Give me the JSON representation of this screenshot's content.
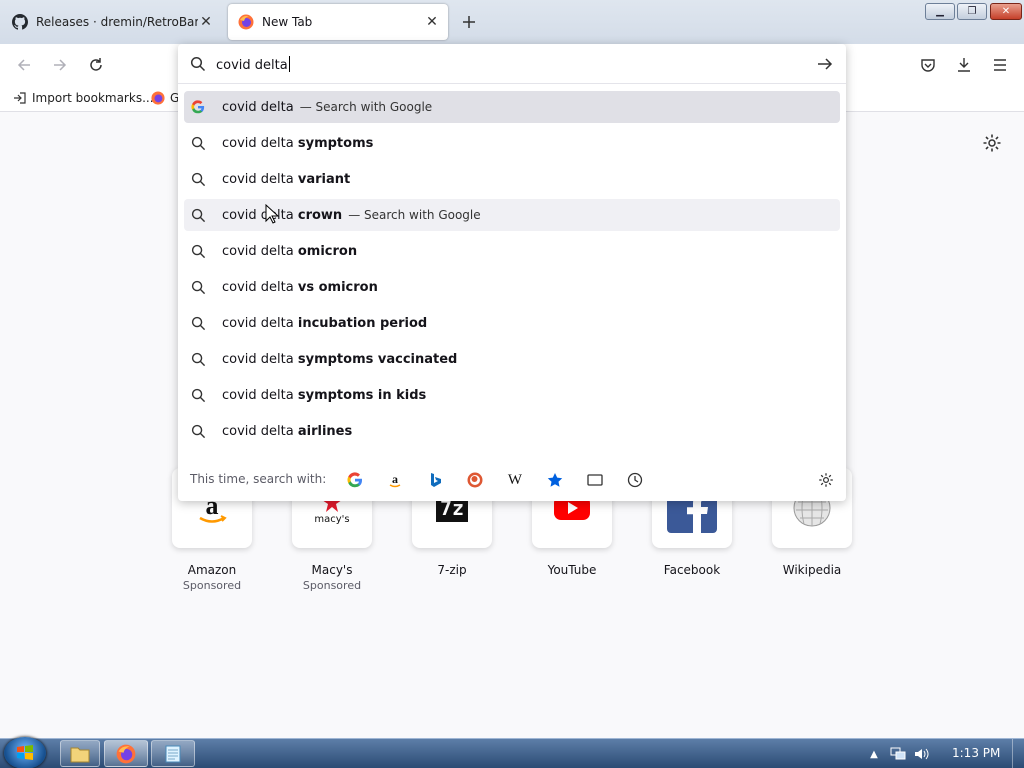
{
  "tabs": [
    {
      "title": "Releases · dremin/RetroBar · Git",
      "icon": "github-icon",
      "active": false
    },
    {
      "title": "New Tab",
      "icon": "firefox-icon",
      "active": true
    }
  ],
  "urlbar": {
    "value": "covid delta",
    "results": [
      {
        "typed": "covid delta",
        "suggest": "",
        "action": "— Search with Google",
        "icon": "google-icon",
        "state": "selected"
      },
      {
        "typed": "covid delta ",
        "suggest": "symptoms",
        "action": "",
        "icon": "search-icon",
        "state": ""
      },
      {
        "typed": "covid delta ",
        "suggest": "variant",
        "action": "",
        "icon": "search-icon",
        "state": ""
      },
      {
        "typed": "covid delta ",
        "suggest": "crown",
        "action": "— Search with Google",
        "icon": "search-icon",
        "state": "hovered"
      },
      {
        "typed": "covid delta ",
        "suggest": "omicron",
        "action": "",
        "icon": "search-icon",
        "state": ""
      },
      {
        "typed": "covid delta ",
        "suggest": "vs omicron",
        "action": "",
        "icon": "search-icon",
        "state": ""
      },
      {
        "typed": "covid delta ",
        "suggest": "incubation period",
        "action": "",
        "icon": "search-icon",
        "state": ""
      },
      {
        "typed": "covid delta ",
        "suggest": "symptoms vaccinated",
        "action": "",
        "icon": "search-icon",
        "state": ""
      },
      {
        "typed": "covid delta ",
        "suggest": "symptoms in kids",
        "action": "",
        "icon": "search-icon",
        "state": ""
      },
      {
        "typed": "covid delta ",
        "suggest": "airlines",
        "action": "",
        "icon": "search-icon",
        "state": ""
      }
    ],
    "oneoff_label": "This time, search with:",
    "oneoff_engines": [
      "google-icon",
      "amazon-icon",
      "bing-icon",
      "duckduckgo-icon",
      "wikipedia-icon",
      "bookmarks-icon",
      "tabs-icon",
      "history-icon"
    ]
  },
  "bookmarks": [
    {
      "label": "Import bookmarks...",
      "icon": "import-icon"
    },
    {
      "label": "G",
      "icon": "firefox-icon"
    }
  ],
  "shortcuts": [
    {
      "title": "Amazon",
      "sponsor": "Sponsored"
    },
    {
      "title": "Macy's",
      "sponsor": "Sponsored",
      "tile_text": "macy's"
    },
    {
      "title": "7-zip",
      "sponsor": "",
      "tile_text": "7z"
    },
    {
      "title": "YouTube",
      "sponsor": ""
    },
    {
      "title": "Facebook",
      "sponsor": ""
    },
    {
      "title": "Wikipedia",
      "sponsor": ""
    }
  ],
  "taskbar": {
    "clock": "1:13 PM"
  },
  "colors": {
    "accent": "#0060df",
    "firefox_orange": "#ff7139",
    "youtube_red": "#ff0000",
    "facebook_blue": "#3b5998"
  }
}
